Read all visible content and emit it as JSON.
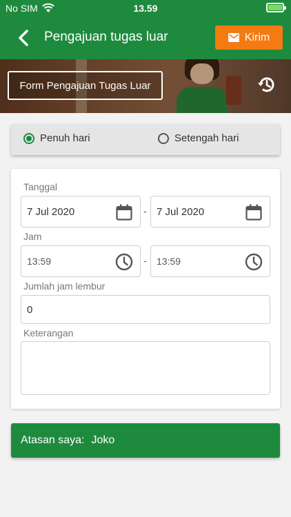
{
  "status_bar": {
    "carrier": "No SIM",
    "time": "13.59"
  },
  "app_bar": {
    "title": "Pengajuan tugas luar",
    "send_label": "Kirim"
  },
  "banner": {
    "form_button_label": "Form Pengajuan Tugas Luar"
  },
  "duration": {
    "options": [
      "Penuh hari",
      "Setengah hari"
    ],
    "selected": "Penuh hari"
  },
  "form": {
    "date_label": "Tanggal",
    "date_from": "7 Jul 2020",
    "date_to": "7 Jul 2020",
    "time_label": "Jam",
    "time_from": "13:59",
    "time_to": "13:59",
    "separator": "-",
    "overtime_label": "Jumlah jam lembur",
    "overtime_value": "0",
    "notes_label": "Keterangan",
    "notes_value": ""
  },
  "supervisor": {
    "label": "Atasan saya:",
    "name": "Joko"
  },
  "colors": {
    "primary": "#1e8a3e",
    "accent": "#f47a12"
  }
}
